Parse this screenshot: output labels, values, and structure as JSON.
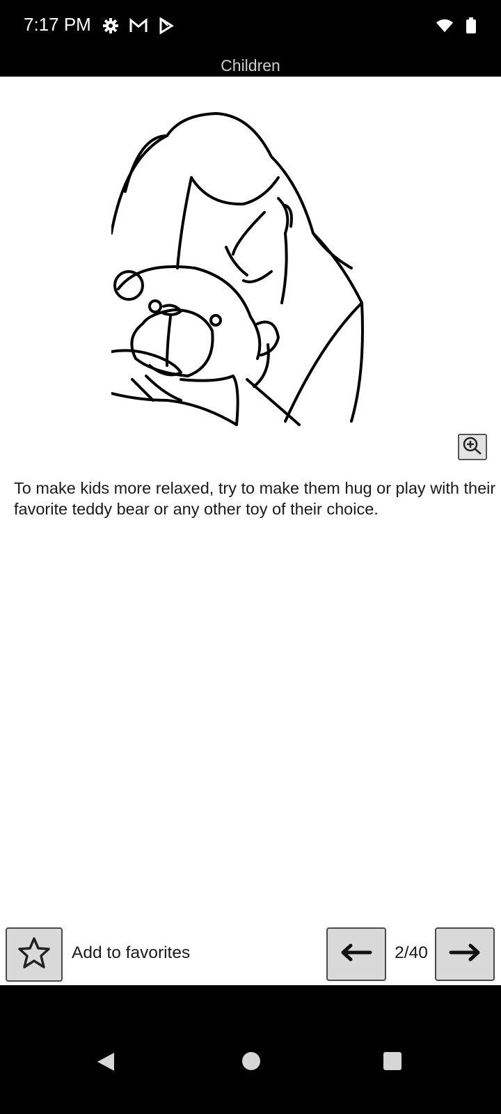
{
  "status_bar": {
    "time": "7:17 PM",
    "left_icons": [
      "settings-icon",
      "gmail-icon",
      "play-store-icon"
    ],
    "right_icons": [
      "wifi-icon",
      "battery-icon"
    ]
  },
  "header": {
    "title": "Children"
  },
  "main": {
    "illustration": "woman-hugging-teddy-bear-line-drawing",
    "zoom_icon": "zoom-in-icon",
    "tip_text": "To make kids more relaxed, try to make them hug or play with their favorite teddy bear or any other toy of their choice."
  },
  "toolbar": {
    "favorite_label": "Add to favorites",
    "favorite_icon": "star-icon",
    "page_counter": "2/40",
    "prev_icon": "arrow-left-icon",
    "next_icon": "arrow-right-icon"
  },
  "nav_bar": {
    "icons": [
      "back-icon",
      "home-icon",
      "recents-icon"
    ]
  },
  "colors": {
    "background": "#ffffff",
    "bars": "#000000",
    "button_fill": "#d9d9d9"
  }
}
